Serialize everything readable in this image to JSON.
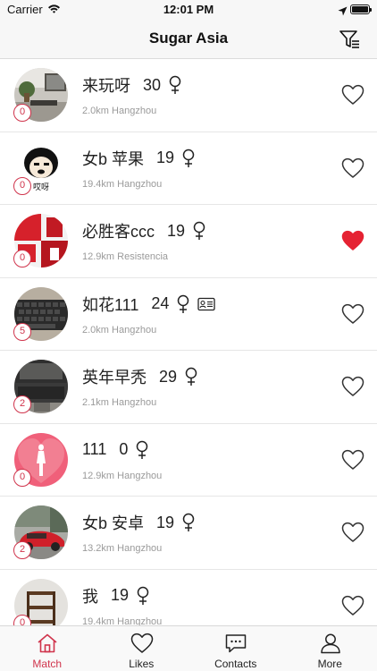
{
  "status_bar": {
    "carrier": "Carrier",
    "time": "12:01 PM"
  },
  "nav": {
    "title": "Sugar Asia",
    "filter_icon": "filter-icon"
  },
  "accent_color": "#d0344c",
  "users": [
    {
      "name": "来玩呀",
      "age": "30",
      "gender": "♀",
      "distance": "2.0km",
      "city": "Hangzhou",
      "badge": "0",
      "liked": false,
      "verified": false,
      "avatar": "room"
    },
    {
      "name": "女b 苹果",
      "age": "19",
      "gender": "♀",
      "distance": "19.4km",
      "city": "Hangzhou",
      "badge": "0",
      "liked": false,
      "verified": false,
      "avatar": "meme"
    },
    {
      "name": "必胜客ccc",
      "age": "19",
      "gender": "♀",
      "distance": "12.9km",
      "city": "Resistencia",
      "badge": "0",
      "liked": true,
      "verified": false,
      "avatar": "red-collage"
    },
    {
      "name": "如花111",
      "age": "24",
      "gender": "♀",
      "distance": "2.0km",
      "city": "Hangzhou",
      "badge": "5",
      "liked": false,
      "verified": true,
      "avatar": "keyboard"
    },
    {
      "name": "英年早秃",
      "age": "29",
      "gender": "♀",
      "distance": "2.1km",
      "city": "Hangzhou",
      "badge": "2",
      "liked": false,
      "verified": false,
      "avatar": "laptop"
    },
    {
      "name": "111",
      "age": "0",
      "gender": "♀",
      "distance": "12.9km",
      "city": "Hangzhou",
      "badge": "0",
      "liked": false,
      "verified": false,
      "avatar": "silhouette"
    },
    {
      "name": "女b 安卓",
      "age": "19",
      "gender": "♀",
      "distance": "13.2km",
      "city": "Hangzhou",
      "badge": "2",
      "liked": false,
      "verified": false,
      "avatar": "car"
    },
    {
      "name": "我",
      "age": "19",
      "gender": "♀",
      "distance": "19.4km",
      "city": "Hangzhou",
      "badge": "0",
      "liked": false,
      "verified": false,
      "avatar": "shelf"
    }
  ],
  "tabs": [
    {
      "label": "Match",
      "icon": "home-icon",
      "active": true
    },
    {
      "label": "Likes",
      "icon": "heart-icon",
      "active": false
    },
    {
      "label": "Contacts",
      "icon": "chat-icon",
      "active": false
    },
    {
      "label": "More",
      "icon": "person-icon",
      "active": false
    }
  ]
}
